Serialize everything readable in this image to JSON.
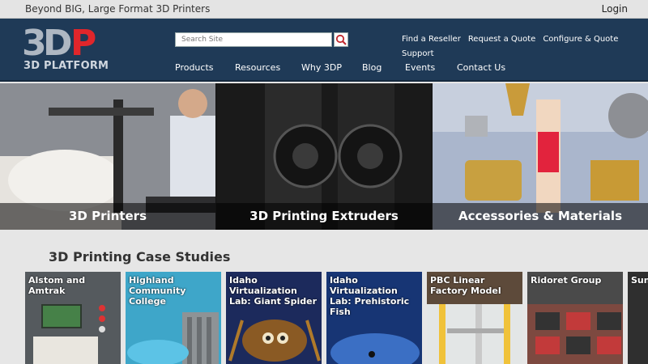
{
  "topbar": {
    "tagline": "Beyond BIG, Large Format 3D Printers",
    "login": "Login"
  },
  "brand": {
    "logo_mark": "3DP",
    "logo_text": "3D PLATFORM",
    "accent": "#e0262b"
  },
  "search": {
    "placeholder": "Search Site",
    "icon": "search-icon"
  },
  "utility_links": [
    "Find a Reseller",
    "Request a Quote",
    "Configure & Quote",
    "Support"
  ],
  "nav": [
    "Products",
    "Resources",
    "Why 3DP",
    "Blog",
    "Events",
    "Contact Us"
  ],
  "hero": [
    {
      "title": "3D Printers"
    },
    {
      "title": "3D Printing Extruders"
    },
    {
      "title": "Accessories & Materials"
    }
  ],
  "case_studies": {
    "heading": "3D Printing Case Studies",
    "items": [
      "Alstom and Amtrak",
      "Highland Community College",
      "Idaho Virtualization Lab: Giant Spider",
      "Idaho Virtualization Lab: Prehistoric Fish",
      "PBC Linear Factory Model",
      "Ridoret Group",
      "Sun Sch"
    ]
  }
}
